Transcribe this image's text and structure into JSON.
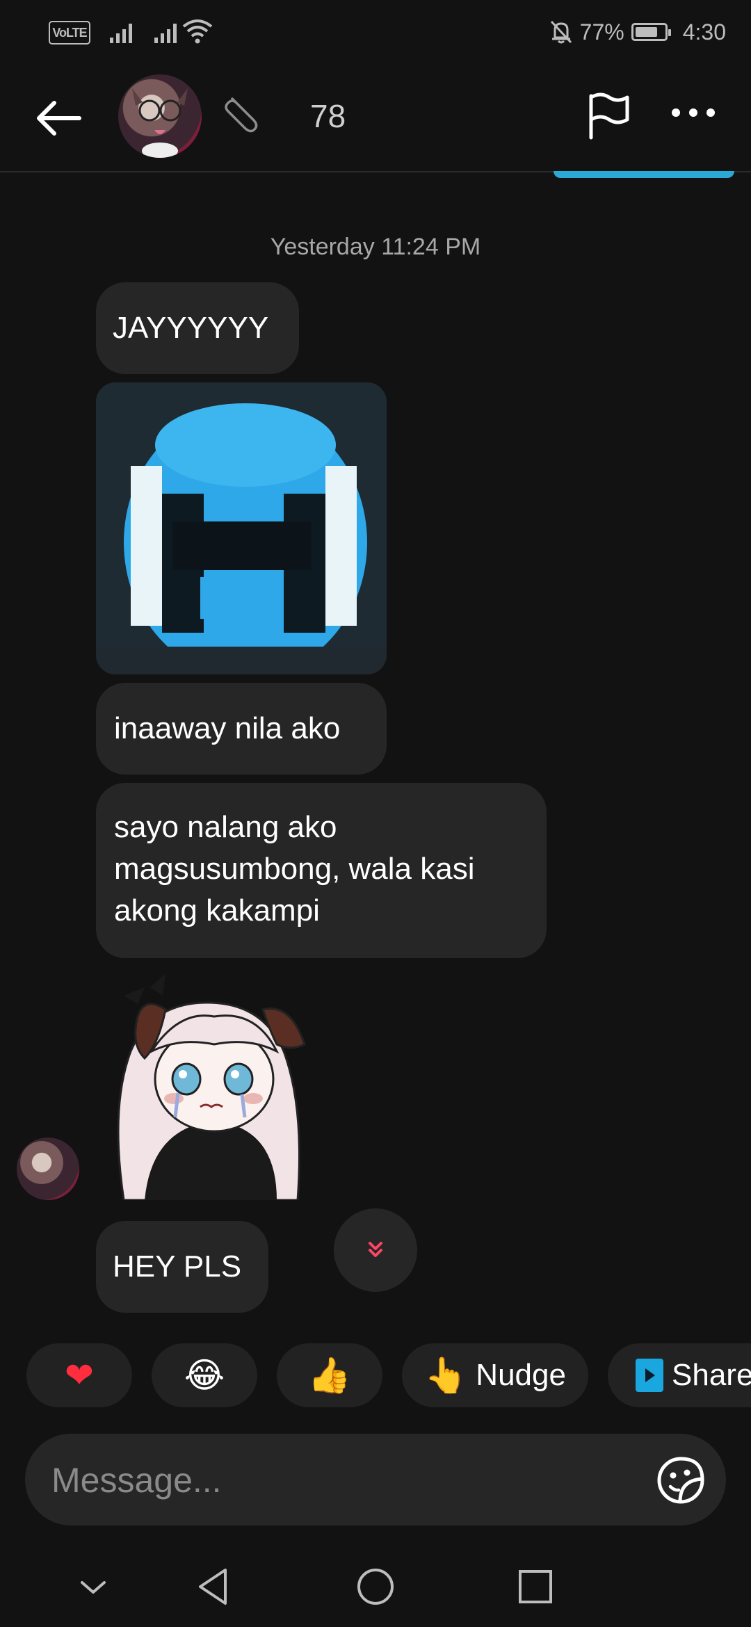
{
  "status_bar": {
    "volte": "VoLTE",
    "battery_percent": "77%",
    "battery_level": 0.77,
    "time": "4:30"
  },
  "header": {
    "member_count": "78"
  },
  "chat": {
    "timestamp": "Yesterday 11:24 PM",
    "messages": [
      {
        "text": "JAYYYYYY"
      },
      {
        "text": "inaaway nila ako"
      },
      {
        "text": "sayo nalang ako magsusumbong, wala kasi akong kakampi"
      },
      {
        "text": "HEY PLS"
      }
    ]
  },
  "quick_replies": {
    "heart": "❤",
    "laugh": "😂",
    "thumbs_up": "👍",
    "nudge_emoji": "👆",
    "nudge_label": "Nudge",
    "share_label": "Share"
  },
  "composer": {
    "placeholder": "Message..."
  },
  "colors": {
    "background": "#121212",
    "bubble": "#262626",
    "accent": "#2aa9d6",
    "scroll_chevron": "#ff4466"
  },
  "icons": [
    "back-arrow-icon",
    "pin-icon",
    "flag-icon",
    "more-icon",
    "chevron-double-down-icon",
    "sticker-icon",
    "nav-back-icon",
    "nav-home-icon",
    "nav-recents-icon",
    "nav-collapse-icon"
  ]
}
